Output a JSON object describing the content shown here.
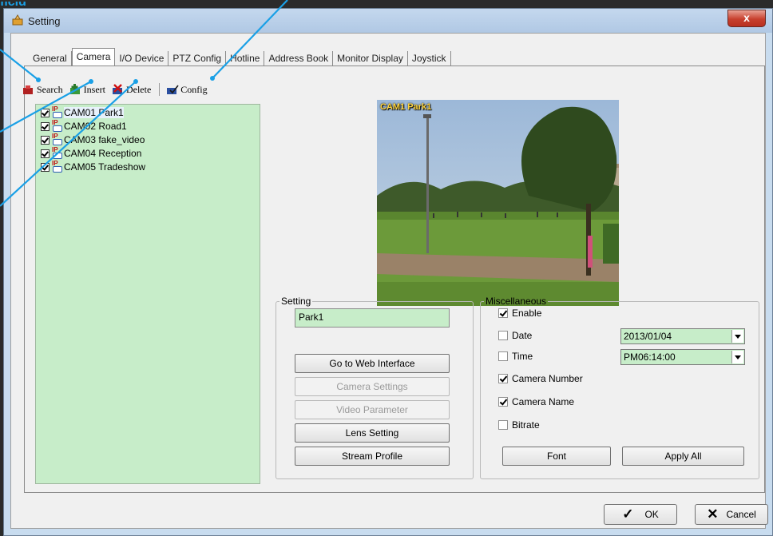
{
  "annotation": {
    "partial_text": "ficld"
  },
  "window": {
    "title": "Setting",
    "close_label": "x"
  },
  "tabs": [
    {
      "label": "General",
      "active": false
    },
    {
      "label": "Camera",
      "active": true
    },
    {
      "label": "I/O Device",
      "active": false
    },
    {
      "label": "PTZ Config",
      "active": false
    },
    {
      "label": "Hotline",
      "active": false
    },
    {
      "label": "Address Book",
      "active": false
    },
    {
      "label": "Monitor Display",
      "active": false
    },
    {
      "label": "Joystick",
      "active": false
    }
  ],
  "toolbar": {
    "search": "Search",
    "insert": "Insert",
    "delete": "Delete",
    "config": "Config"
  },
  "cameras": [
    {
      "label": "CAM01 Park1",
      "checked": true
    },
    {
      "label": "CAM02 Road1",
      "checked": true
    },
    {
      "label": "CAM03 fake_video",
      "checked": true
    },
    {
      "label": "CAM04 Reception",
      "checked": true
    },
    {
      "label": "CAM05 Tradeshow",
      "checked": true
    }
  ],
  "preview": {
    "overlay_label": "CAM1 Park1"
  },
  "setting_group": {
    "legend": "Setting",
    "name_value": "Park1",
    "buttons": {
      "web": "Go to Web Interface",
      "camera_settings": "Camera Settings",
      "video_parameter": "Video Parameter",
      "lens_setting": "Lens Setting",
      "stream_profile": "Stream Profile"
    }
  },
  "misc_group": {
    "legend": "Miscellaneous",
    "enable": {
      "label": "Enable",
      "checked": true
    },
    "date": {
      "label": "Date",
      "checked": false,
      "value": "2013/01/04"
    },
    "time": {
      "label": "Time",
      "checked": false,
      "value": "PM06:14:00"
    },
    "camera_number": {
      "label": "Camera Number",
      "checked": true
    },
    "camera_name": {
      "label": "Camera Name",
      "checked": true
    },
    "bitrate": {
      "label": "Bitrate",
      "checked": false
    },
    "font_button": "Font",
    "apply_all_button": "Apply All"
  },
  "footer": {
    "ok": "OK",
    "cancel": "Cancel"
  },
  "colors": {
    "annotation": "#1aa0e6",
    "list_bg": "#c7edc9",
    "title_bg": "#c4d8ee",
    "close_red": "#c7402e"
  }
}
